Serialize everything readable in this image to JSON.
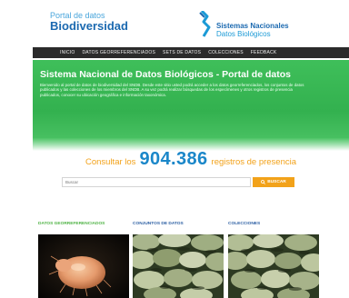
{
  "header": {
    "logo_left": {
      "line1": "Portal de datos",
      "line2": "Biodiversidad"
    },
    "logo_right": {
      "line1": "Sistemas Nacionales",
      "line2": "Datos Biológicos"
    }
  },
  "nav": {
    "items": [
      {
        "label": "INICIO"
      },
      {
        "label": "DATOS GEORREFERENCIADOS"
      },
      {
        "label": "SETS DE DATOS"
      },
      {
        "label": "COLECCIONES"
      },
      {
        "label": "FEEDBACK"
      }
    ]
  },
  "hero": {
    "title": "Sistema Nacional de Datos Biológicos - Portal de datos",
    "description": "Bienvenido al portal de datos de biodiversidad del SNDB. Desde este sitio usted podrá acceder a los datos georreferenciados, los conjuntos de datos publicados y las colecciones de los miembros del SNDB. A su vez podrá realizar búsquedas de los especímenes y otros registros de presencia publicados, conocer su ubicación geográfica e información taxonómica."
  },
  "counter": {
    "prefix": "Consultar los",
    "value": "904.386",
    "suffix": "registros de presencia"
  },
  "search": {
    "placeholder": "Buscar",
    "button_label": "BUSCAR"
  },
  "sections": {
    "georef": {
      "label": "DATOS GEORREFERENCIADOS"
    },
    "datasets": {
      "label": "CONJUNTOS DE DATOS"
    },
    "collections": {
      "label": "COLECCIONES"
    }
  },
  "colors": {
    "hero_green": "#3fbf5a",
    "accent_orange": "#f2a21a",
    "brand_blue": "#1b69b0",
    "nav_dark": "#2b2b2b"
  }
}
